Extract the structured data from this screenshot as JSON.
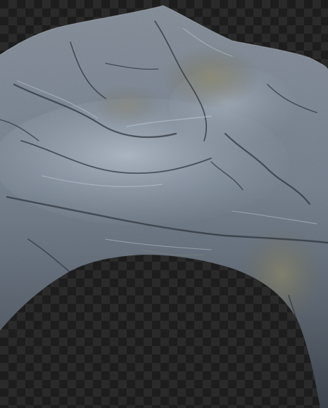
{
  "image": {
    "subject": "rock-arch",
    "background": "transparency-checkerboard"
  },
  "colors": {
    "rock_light": "#a9b4c2",
    "rock_mid": "#6f7a88",
    "rock_dark": "#3b424c",
    "moss": "#7d7a5e",
    "checker_dark": "#1d1d1d",
    "checker_light": "#2a2a2a"
  }
}
